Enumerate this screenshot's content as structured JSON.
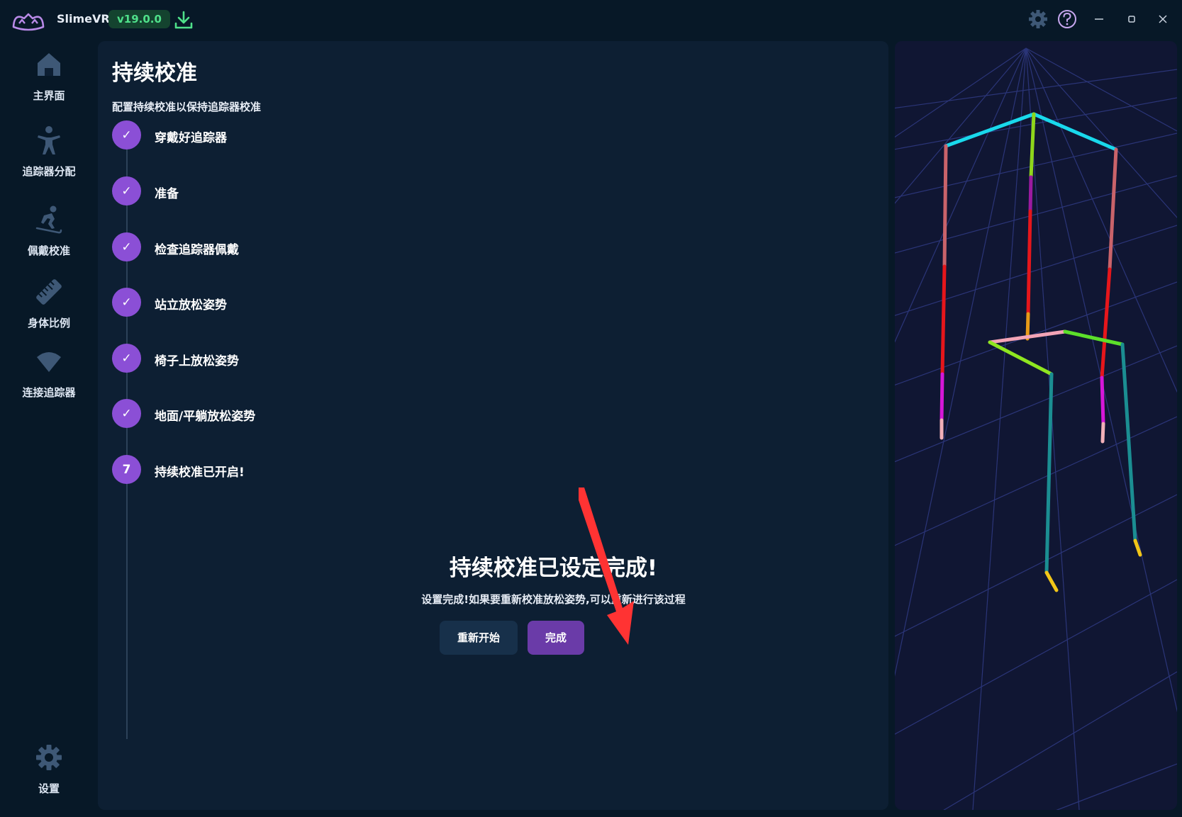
{
  "app": {
    "name": "SlimeVR",
    "version": "v19.0.0"
  },
  "sidebar": {
    "items": [
      {
        "label": "主界面",
        "icon": "home-icon"
      },
      {
        "label": "追踪器分配",
        "icon": "person-icon"
      },
      {
        "label": "佩戴校准",
        "icon": "skier-icon"
      },
      {
        "label": "身体比例",
        "icon": "ruler-icon"
      },
      {
        "label": "连接追踪器",
        "icon": "wifi-icon"
      }
    ],
    "settings_label": "设置"
  },
  "main": {
    "title": "持续校准",
    "subtitle": "配置持续校准以保持追踪器校准",
    "steps": [
      {
        "label": "穿戴好追踪器",
        "marker": "✓"
      },
      {
        "label": "准备",
        "marker": "✓"
      },
      {
        "label": "检查追踪器佩戴",
        "marker": "✓"
      },
      {
        "label": "站立放松姿势",
        "marker": "✓"
      },
      {
        "label": "椅子上放松姿势",
        "marker": "✓"
      },
      {
        "label": "地面/平躺放松姿势",
        "marker": "✓"
      },
      {
        "label": "持续校准已开启!",
        "marker": "7"
      }
    ],
    "done_title": "持续校准已设定完成!",
    "done_description": "设置完成!如果要重新校准放松姿势,可以重新进行该过程",
    "restart_button": "重新开始",
    "done_button": "完成"
  },
  "colors": {
    "accent": "#8b4fd6",
    "done_button": "#6a3ba8",
    "version_text": "#4fe08a",
    "annotation_arrow": "#ff3333"
  }
}
